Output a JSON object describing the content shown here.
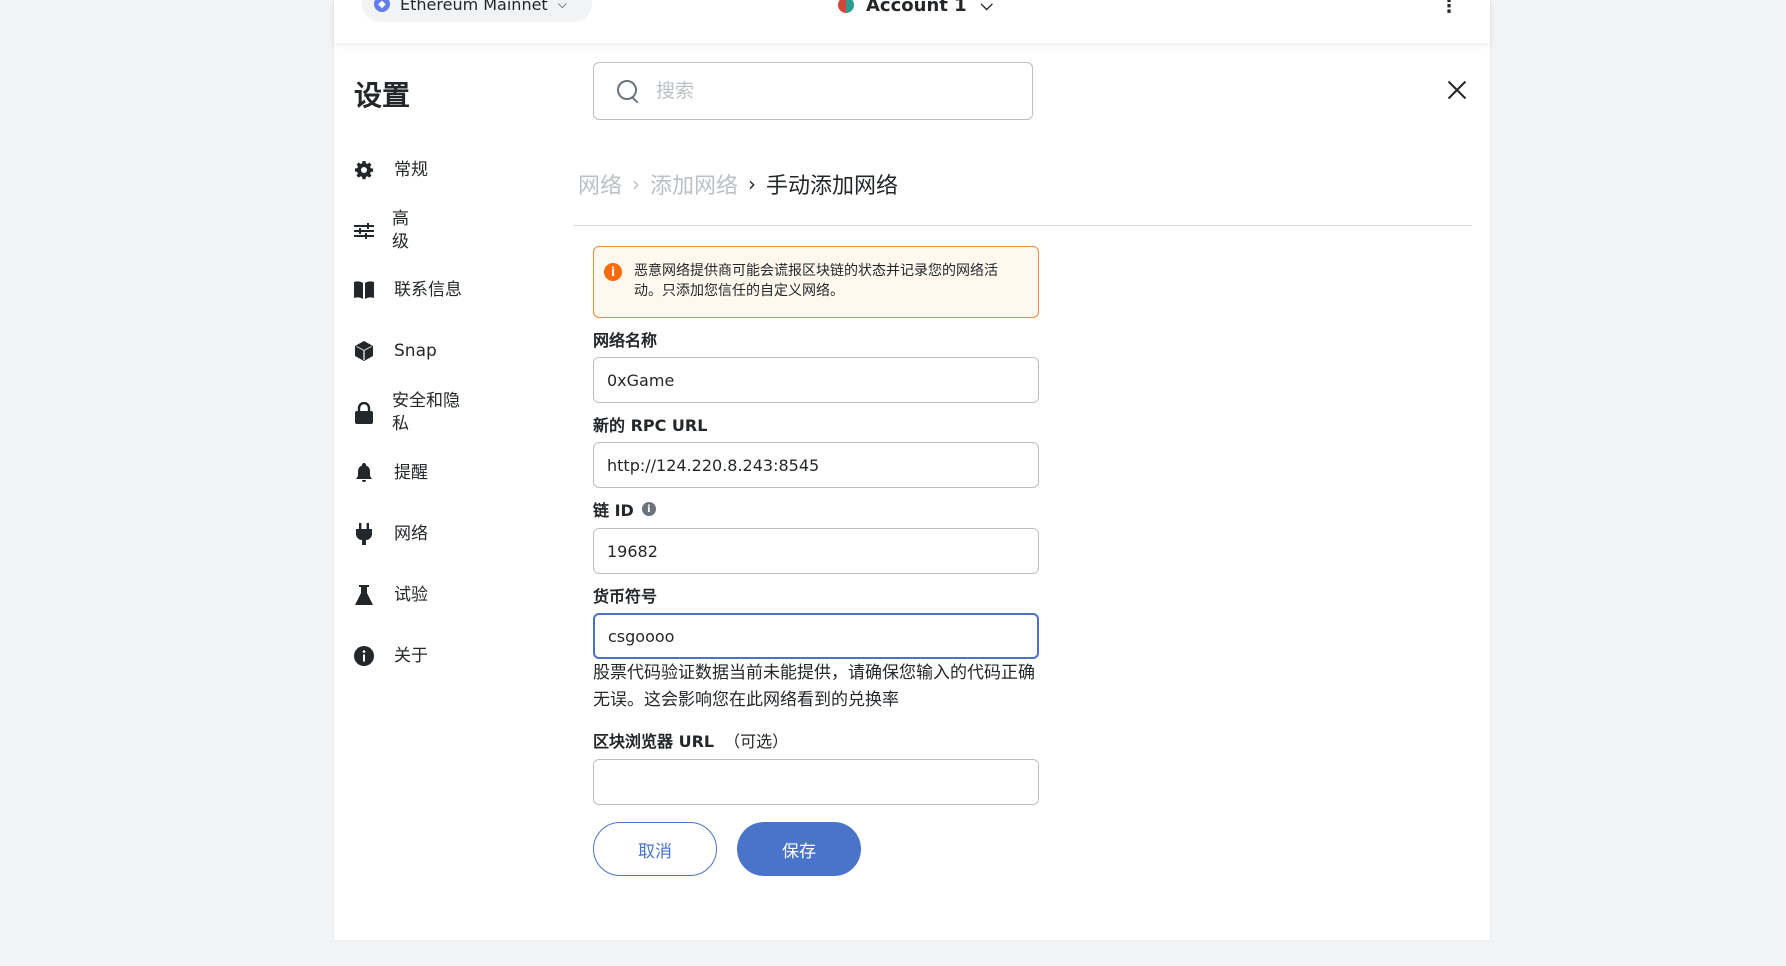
{
  "topbar": {
    "network_label": "Ethereum Mainnet",
    "network_icon": "eth-icon",
    "account_label": "Account 1",
    "menu_icon": "kebab-menu-icon"
  },
  "settings": {
    "title": "设置",
    "search_placeholder": "搜索"
  },
  "sidebar": {
    "items": [
      {
        "label": "常规",
        "icon": "gear-icon"
      },
      {
        "label": "高\n级",
        "icon": "sliders-icon"
      },
      {
        "label": "联系信息",
        "icon": "book-icon"
      },
      {
        "label": "Snap",
        "icon": "cube-icon"
      },
      {
        "label": "安全和隐\n私",
        "icon": "lock-icon"
      },
      {
        "label": "提醒",
        "icon": "bell-icon"
      },
      {
        "label": "网络",
        "icon": "plug-icon"
      },
      {
        "label": "试验",
        "icon": "flask-icon"
      },
      {
        "label": "关于",
        "icon": "info-icon"
      }
    ]
  },
  "breadcrumb": {
    "level1": "网络",
    "level2": "添加网络",
    "current": "手动添加网络"
  },
  "warning": {
    "text": "恶意网络提供商可能会谎报区块链的状态并记录您的网络活动。只添加您信任的自定义网络。"
  },
  "form": {
    "network_name": {
      "label": "网络名称",
      "value": "0xGame"
    },
    "rpc_url": {
      "label": "新的 RPC URL",
      "value": "http://124.220.8.243:8545"
    },
    "chain_id": {
      "label": "链 ID",
      "value": "19682"
    },
    "currency_symbol": {
      "label": "货币符号",
      "value": "csgoooo",
      "helper": "股票代码验证数据当前未能提供，请确保您输入的代码正确无误。这会影响您在此网络看到的兑换率"
    },
    "explorer_url": {
      "label": "区块浏览器 URL",
      "optional": "（可选）",
      "value": ""
    }
  },
  "buttons": {
    "cancel": "取消",
    "save": "保存"
  },
  "colors": {
    "primary": "#4a74c9",
    "warning_border": "#f8883b",
    "warning_bg": "#fef8ee"
  }
}
